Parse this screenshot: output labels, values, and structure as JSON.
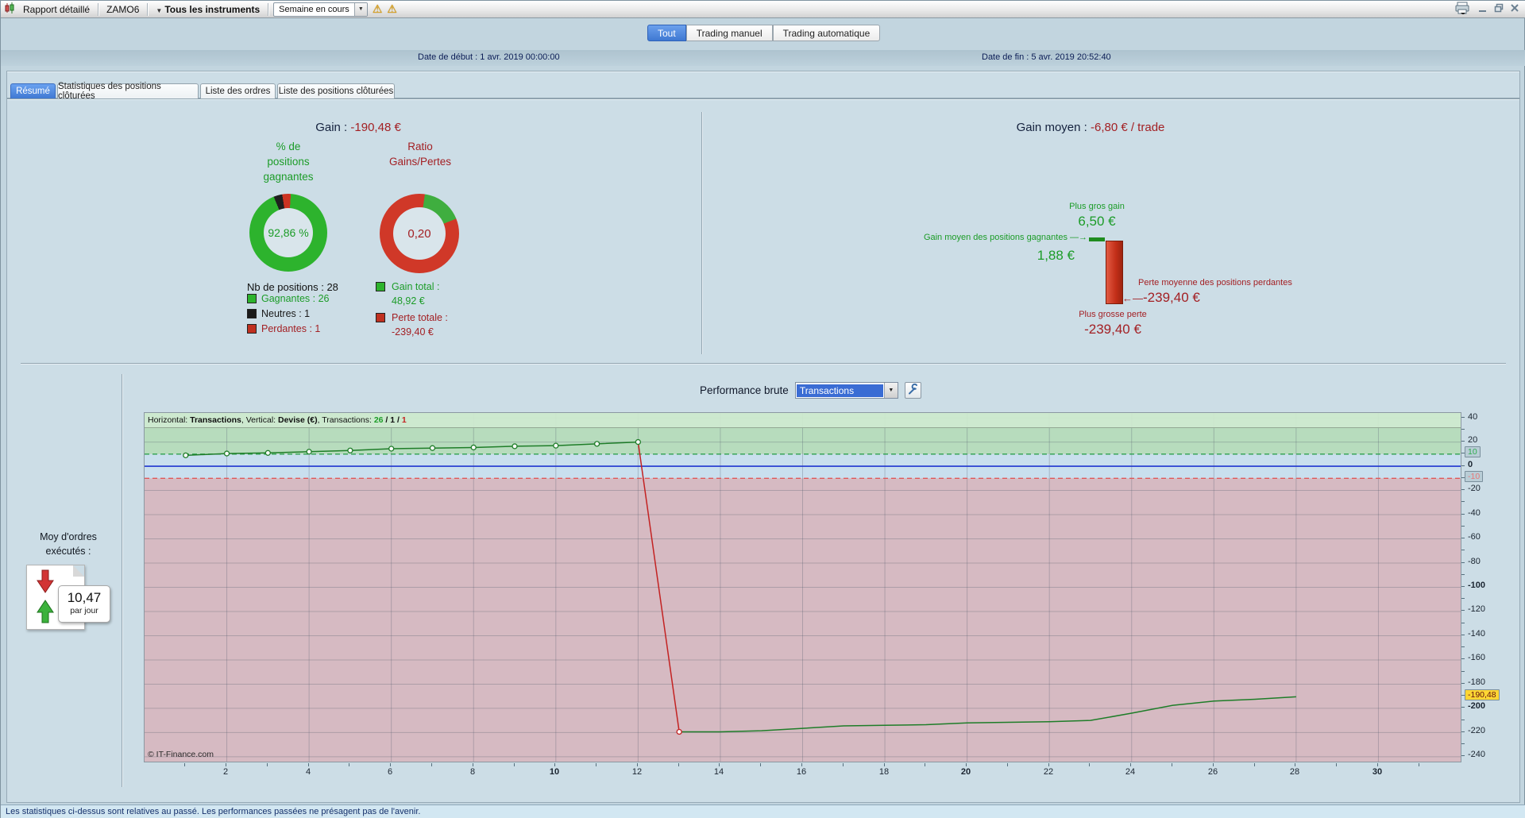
{
  "colors": {
    "accent_blue": "#3f78d2",
    "win_green": "#2db32d",
    "loss_red": "#c32222",
    "neutral_black": "#1a1a1a",
    "marker_yellow": "#ffd633"
  },
  "window": {
    "toolbar": {
      "report_label": "Rapport détaillé",
      "instrument_code": "ZAMO6",
      "instruments_label": "Tous les instruments",
      "period_value": "Semaine en cours",
      "warning_icon": "⚠"
    },
    "mode_tabs": [
      {
        "label": "Tout",
        "selected": true
      },
      {
        "label": "Trading manuel",
        "selected": false
      },
      {
        "label": "Trading automatique",
        "selected": false
      }
    ],
    "date_start": "Date de début :  1 avr. 2019 00:00:00",
    "date_end": "Date de fin :  5 avr. 2019 20:52:40",
    "status_text": "Les statistiques ci-dessus sont relatives au passé. Les performances passées ne présagent pas de l'avenir."
  },
  "tabs": [
    "Résumé",
    "Statistiques des positions clôturées",
    "Liste des ordres",
    "Liste des positions clôturées"
  ],
  "summary": {
    "gain_label": "Gain :",
    "gain_value": "-190,48 €",
    "winrate_title": [
      "% de",
      "positions",
      "gagnantes"
    ],
    "ratio_title": [
      "Ratio",
      "Gains/Pertes"
    ],
    "donut_winrate": {
      "value": "92,86 %",
      "start_deg": -22,
      "segments": [
        {
          "color": "#1f1f1f",
          "pct": 3.57
        },
        {
          "color": "#cc3322",
          "pct": 3.57
        },
        {
          "color": "#2db32d",
          "pct": 92.86
        }
      ]
    },
    "donut_ratio": {
      "value": "0,20",
      "start_deg": 8,
      "segments": [
        {
          "color": "#3fae3f",
          "pct": 16.7
        },
        {
          "color": "#d03828",
          "pct": 83.3
        }
      ]
    },
    "positions_label": "Nb de positions : 28",
    "legend": [
      {
        "label": "Gagnantes : 26",
        "color": "#2db32d"
      },
      {
        "label": "Neutres : 1",
        "color": "#1a1a1a"
      },
      {
        "label": "Perdantes : 1",
        "color": "#c03020"
      }
    ],
    "gain_total_label": "Gain total :",
    "gain_total_value": "48,92 €",
    "loss_total_label": "Perte totale :",
    "loss_total_value": "-239,40 €"
  },
  "average": {
    "title_label": "Gain moyen :",
    "title_value": "-6,80 € / trade",
    "biggest_gain_label": "Plus gros gain",
    "biggest_gain_value": "6,50 €",
    "avg_win_label": "Gain moyen des positions gagnantes —→",
    "avg_win_value": "1,88 €",
    "avg_loss_arrow": "←—",
    "avg_loss_label": "Perte moyenne des positions perdantes",
    "avg_loss_value": "-239,40 €",
    "biggest_loss_label": "Plus grosse perte",
    "biggest_loss_value": "-239,40 €"
  },
  "orders_widget": {
    "label_line1": "Moy d'ordres",
    "label_line2": "exécutés :",
    "value": "10,47",
    "unit": "par jour"
  },
  "performance": {
    "label": "Performance brute",
    "select_value": "Transactions"
  },
  "chart_data": {
    "type": "line",
    "title": "Performance brute",
    "xlabel": "Transactions",
    "ylabel": "Devise (€)",
    "header_parts": [
      "Horizontal: ",
      "Transactions",
      ", Vertical: ",
      "Devise (€)",
      ", Transactions: ",
      "26",
      " / ",
      "1",
      " / ",
      "1"
    ],
    "x": [
      1,
      2,
      3,
      4,
      5,
      6,
      7,
      8,
      9,
      10,
      11,
      12,
      13,
      14,
      15,
      16,
      17,
      18,
      19,
      20,
      21,
      22,
      23,
      24,
      25,
      26,
      27,
      28
    ],
    "y": [
      9,
      10.5,
      11,
      12,
      13,
      14.5,
      15,
      15.5,
      16.5,
      17,
      18.5,
      20,
      -219.4,
      -219.4,
      -218.5,
      -216.5,
      -214.5,
      -214,
      -213.5,
      -212,
      -211.5,
      -211,
      -210,
      -204,
      -197.5,
      -194,
      -192.5,
      -190.48
    ],
    "loss_segment_start_index": 11,
    "xlim": [
      0,
      32
    ],
    "ylim": [
      -244,
      44
    ],
    "x_major_ticks": [
      2,
      4,
      6,
      8,
      10,
      12,
      14,
      16,
      18,
      20,
      22,
      24,
      26,
      28,
      30
    ],
    "x_bold_ticks": [
      10,
      20,
      30
    ],
    "y_major_ticks": [
      40,
      20,
      0,
      -20,
      -40,
      -60,
      -80,
      -100,
      -120,
      -140,
      -160,
      -180,
      -200,
      -220,
      -240
    ],
    "y_bold_ticks": [
      0,
      -100,
      -200
    ],
    "band_upper": 10,
    "band_lower": -10,
    "axis_markers": [
      {
        "value": 10,
        "label": "10",
        "bg": "#b9cdd6",
        "fg": "#2fae4f"
      },
      {
        "value": -10,
        "label": "-10",
        "bg": "#b9cdd6",
        "fg": "#e87878"
      },
      {
        "value": -190.48,
        "label": "-190,48",
        "bg": "#ffd633",
        "fg": "#5c1010"
      }
    ],
    "grid": true,
    "legend_position": "none",
    "copyright": "© IT-Finance.com",
    "colors": {
      "win_line": "#1e7d28",
      "loss_line": "#c32222",
      "zone_pos": "#b7dcbd",
      "zone_neutral": "#c9dfee",
      "zone_neg": "#d6bac2",
      "zero_line": "#1f35cf",
      "band_upper_line": "#2ea04e",
      "band_lower_line": "#e05858"
    }
  }
}
